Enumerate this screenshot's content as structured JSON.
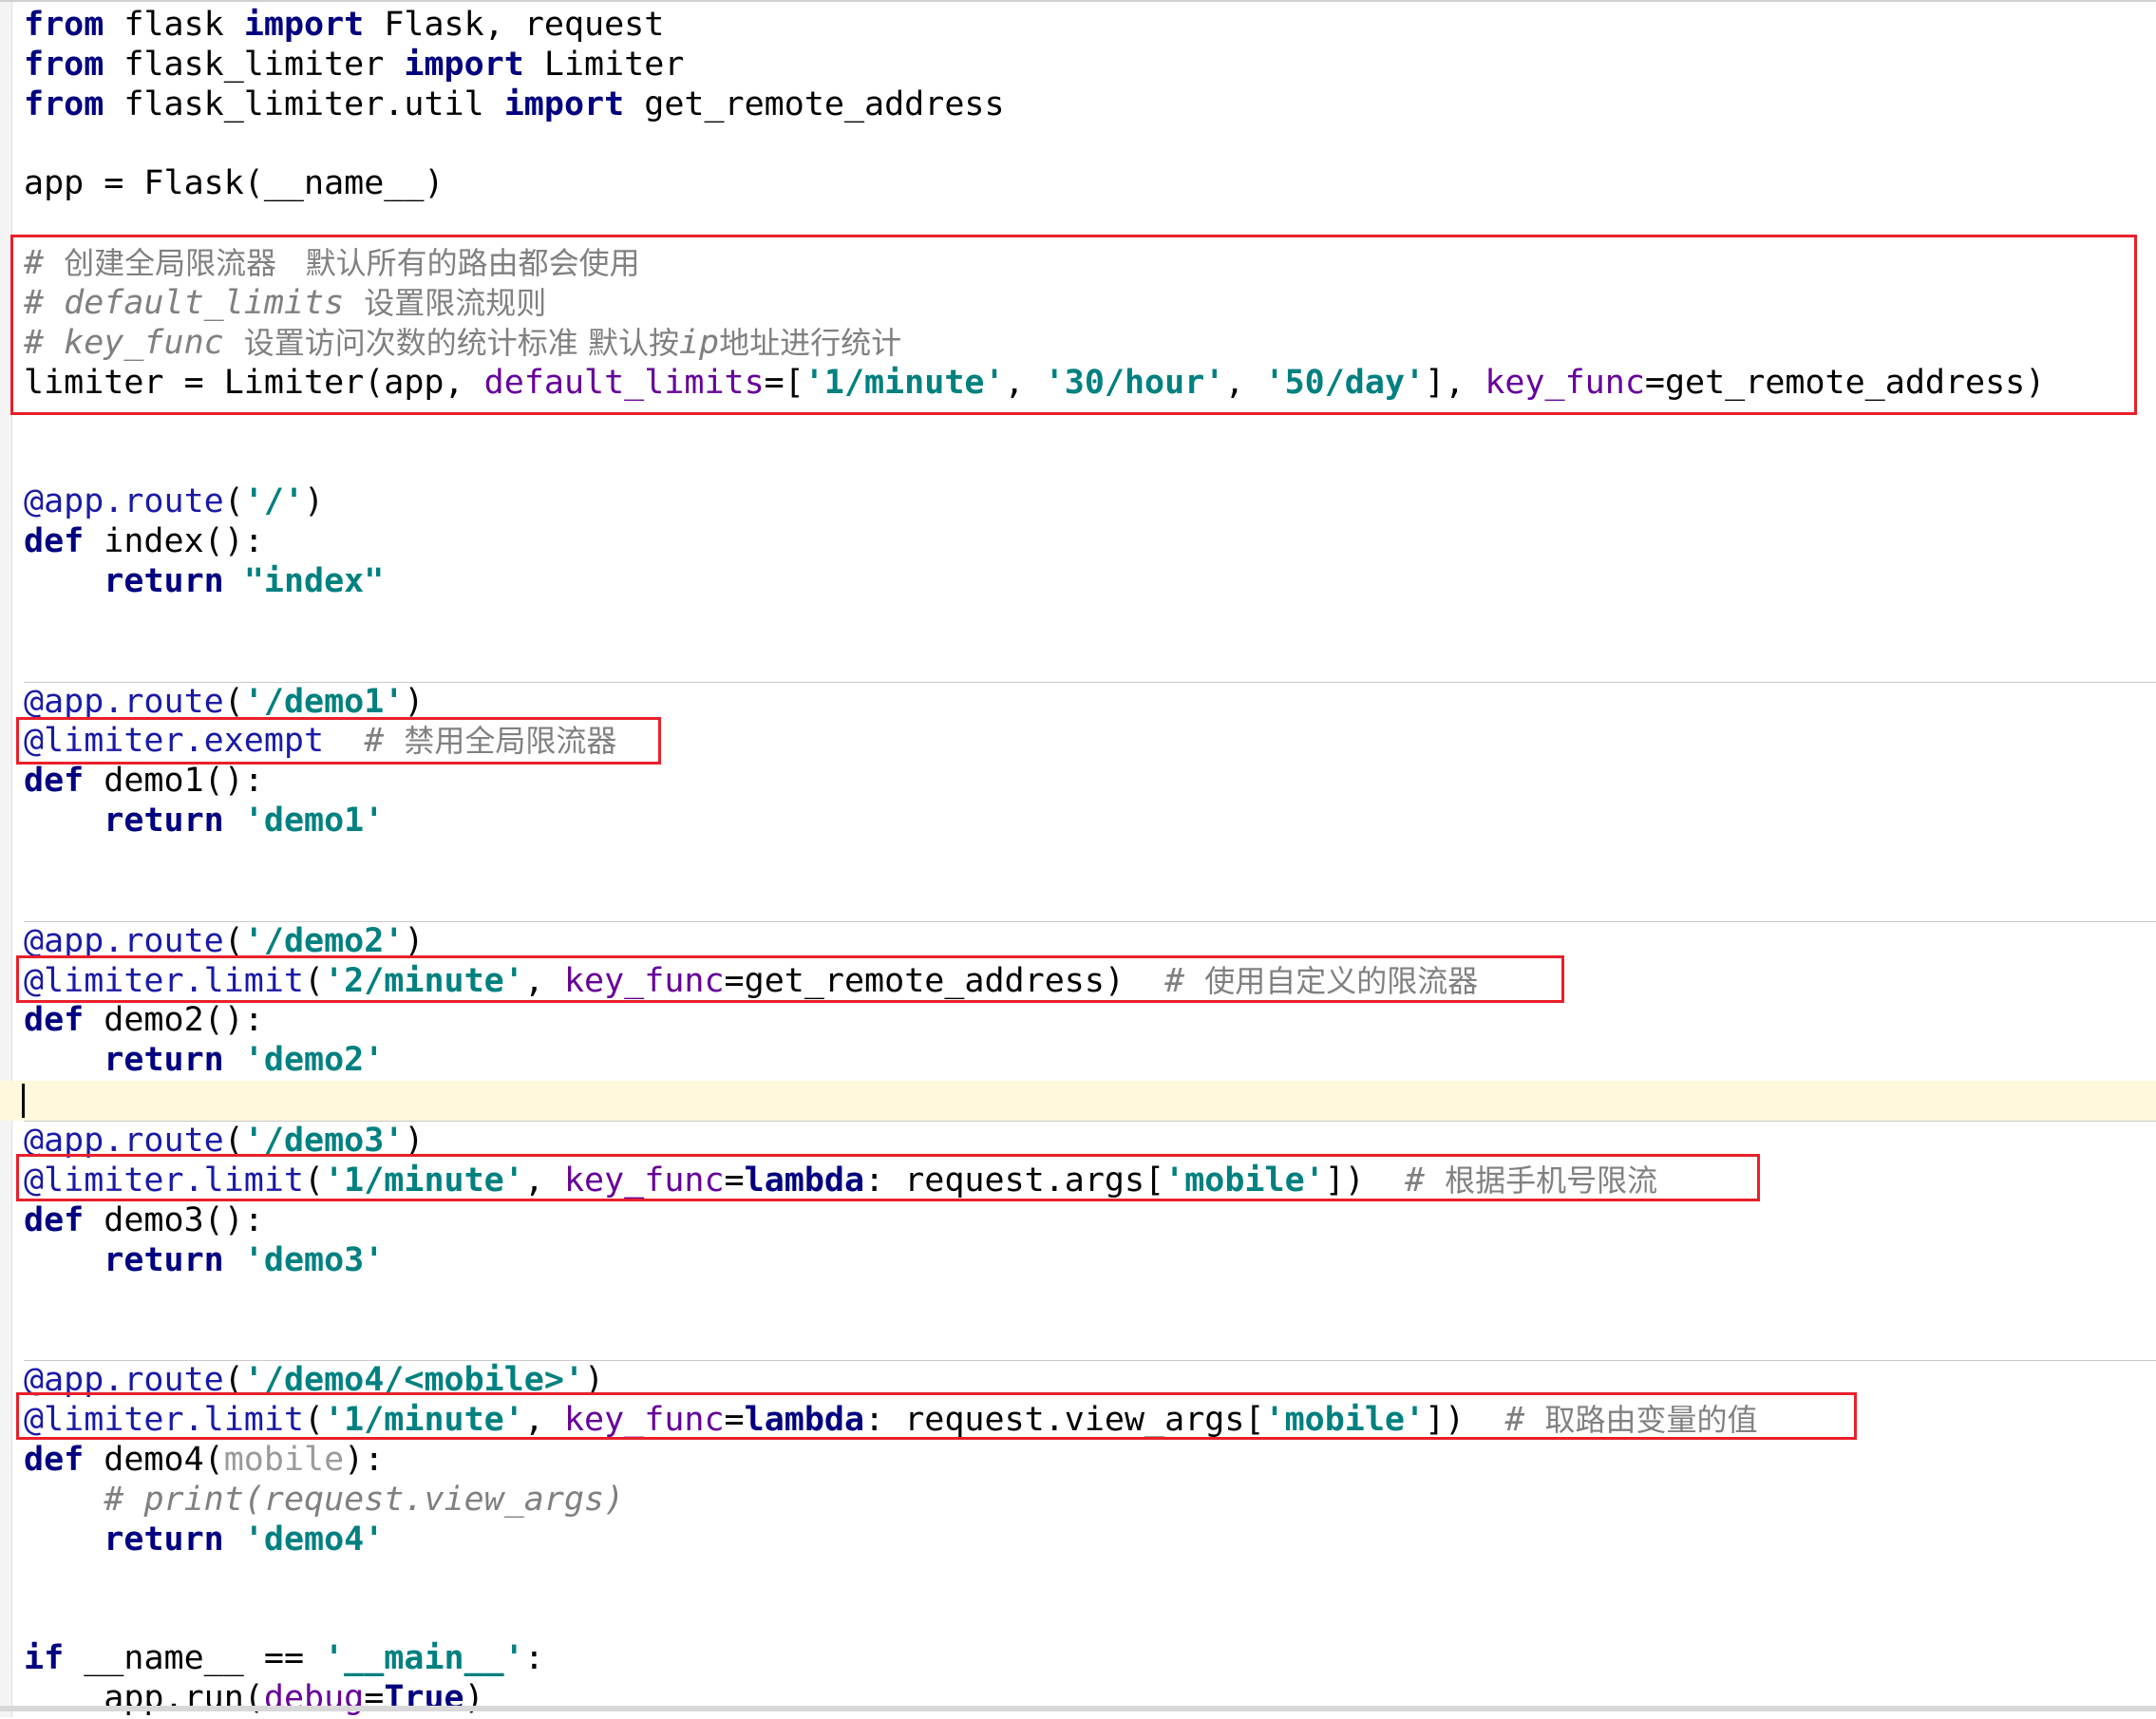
{
  "editor": {
    "language": "python",
    "highlight_color": "#e8202a",
    "current_line": 27,
    "lines": [
      [
        [
          "kw",
          "from"
        ],
        [
          "plain",
          " flask "
        ],
        [
          "kw",
          "import"
        ],
        [
          "plain",
          " Flask, request"
        ]
      ],
      [
        [
          "kw",
          "from"
        ],
        [
          "plain",
          " flask_limiter "
        ],
        [
          "kw",
          "import"
        ],
        [
          "plain",
          " Limiter"
        ]
      ],
      [
        [
          "kw",
          "from"
        ],
        [
          "plain",
          " flask_limiter.util "
        ],
        [
          "kw",
          "import"
        ],
        [
          "plain",
          " get_remote_address"
        ]
      ],
      [],
      [
        [
          "plain",
          "app = Flask(__name__)"
        ]
      ],
      [],
      [
        [
          "cmt",
          "# "
        ],
        [
          "cjk",
          "创建全局限流器   默认所有的路由都会使用"
        ]
      ],
      [
        [
          "cmt",
          "# default_limits "
        ],
        [
          "cjk",
          "设置限流规则"
        ]
      ],
      [
        [
          "cmt",
          "# key_func "
        ],
        [
          "cjk",
          "设置访问次数的统计标准 默认按"
        ],
        [
          "cmt",
          "ip"
        ],
        [
          "cjk",
          "地址进行统计"
        ]
      ],
      [
        [
          "plain",
          "limiter = Limiter(app, "
        ],
        [
          "kwarg",
          "default_limits"
        ],
        [
          "plain",
          "=["
        ],
        [
          "str",
          "'1/minute'"
        ],
        [
          "plain",
          ", "
        ],
        [
          "str",
          "'30/hour'"
        ],
        [
          "plain",
          ", "
        ],
        [
          "str",
          "'50/day'"
        ],
        [
          "plain",
          "], "
        ],
        [
          "kwarg",
          "key_func"
        ],
        [
          "plain",
          "=get_remote_address)"
        ]
      ],
      [],
      [],
      [
        [
          "dec",
          "@app.route"
        ],
        [
          "plain",
          "("
        ],
        [
          "str",
          "'/'"
        ],
        [
          "plain",
          ")"
        ]
      ],
      [
        [
          "kw",
          "def"
        ],
        [
          "plain",
          " index():"
        ]
      ],
      [
        [
          "plain",
          "    "
        ],
        [
          "kw",
          "return"
        ],
        [
          "plain",
          " "
        ],
        [
          "str",
          "\"index\""
        ]
      ],
      [],
      [],
      [
        [
          "dec",
          "@app.route"
        ],
        [
          "plain",
          "("
        ],
        [
          "str",
          "'/demo1'"
        ],
        [
          "plain",
          ")"
        ]
      ],
      [
        [
          "dec",
          "@limiter.exempt"
        ],
        [
          "plain",
          "  "
        ],
        [
          "cmt",
          "# "
        ],
        [
          "cjk",
          "禁用全局限流器"
        ]
      ],
      [
        [
          "kw",
          "def"
        ],
        [
          "plain",
          " demo1():"
        ]
      ],
      [
        [
          "plain",
          "    "
        ],
        [
          "kw",
          "return"
        ],
        [
          "plain",
          " "
        ],
        [
          "str",
          "'demo1'"
        ]
      ],
      [],
      [],
      [
        [
          "dec",
          "@app.route"
        ],
        [
          "plain",
          "("
        ],
        [
          "str",
          "'/demo2'"
        ],
        [
          "plain",
          ")"
        ]
      ],
      [
        [
          "dec",
          "@limiter.limit"
        ],
        [
          "plain",
          "("
        ],
        [
          "str",
          "'2/minute'"
        ],
        [
          "plain",
          ", "
        ],
        [
          "kwarg",
          "key_func"
        ],
        [
          "plain",
          "=get_remote_address)  "
        ],
        [
          "cmt",
          "# "
        ],
        [
          "cjk",
          "使用自定义的限流器"
        ]
      ],
      [
        [
          "kw",
          "def"
        ],
        [
          "plain",
          " demo2():"
        ]
      ],
      [
        [
          "plain",
          "    "
        ],
        [
          "kw",
          "return"
        ],
        [
          "plain",
          " "
        ],
        [
          "str",
          "'demo2'"
        ]
      ],
      [],
      [
        [
          "dec",
          "@app.route"
        ],
        [
          "plain",
          "("
        ],
        [
          "str",
          "'/demo3'"
        ],
        [
          "plain",
          ")"
        ]
      ],
      [
        [
          "dec",
          "@limiter.limit"
        ],
        [
          "plain",
          "("
        ],
        [
          "str",
          "'1/minute'"
        ],
        [
          "plain",
          ", "
        ],
        [
          "kwarg",
          "key_func"
        ],
        [
          "plain",
          "="
        ],
        [
          "kw",
          "lambda"
        ],
        [
          "plain",
          ": request.args["
        ],
        [
          "str",
          "'mobile'"
        ],
        [
          "plain",
          "])  "
        ],
        [
          "cmt",
          "# "
        ],
        [
          "cjk",
          "根据手机号限流"
        ]
      ],
      [
        [
          "kw",
          "def"
        ],
        [
          "plain",
          " demo3():"
        ]
      ],
      [
        [
          "plain",
          "    "
        ],
        [
          "kw",
          "return"
        ],
        [
          "plain",
          " "
        ],
        [
          "str",
          "'demo3'"
        ]
      ],
      [],
      [],
      [
        [
          "dec",
          "@app.route"
        ],
        [
          "plain",
          "("
        ],
        [
          "str",
          "'/demo4/<mobile>'"
        ],
        [
          "plain",
          ")"
        ]
      ],
      [
        [
          "dec",
          "@limiter.limit"
        ],
        [
          "plain",
          "("
        ],
        [
          "str",
          "'1/minute'"
        ],
        [
          "plain",
          ", "
        ],
        [
          "kwarg",
          "key_func"
        ],
        [
          "plain",
          "="
        ],
        [
          "kw",
          "lambda"
        ],
        [
          "plain",
          ": request.view_args["
        ],
        [
          "str",
          "'mobile'"
        ],
        [
          "plain",
          "])  "
        ],
        [
          "cmt",
          "# "
        ],
        [
          "cjk",
          "取路由变量的值"
        ]
      ],
      [
        [
          "kw",
          "def"
        ],
        [
          "plain",
          " demo4("
        ],
        [
          "param",
          "mobile"
        ],
        [
          "plain",
          "):"
        ]
      ],
      [
        [
          "plain",
          "    "
        ],
        [
          "cmt",
          "# print(request.view_args)"
        ]
      ],
      [
        [
          "plain",
          "    "
        ],
        [
          "kw",
          "return"
        ],
        [
          "plain",
          " "
        ],
        [
          "str",
          "'demo4'"
        ]
      ],
      [],
      [],
      [
        [
          "kw",
          "if"
        ],
        [
          "plain",
          " __name__ == "
        ],
        [
          "str",
          "'__main__'"
        ],
        [
          "plain",
          ":"
        ]
      ],
      [
        [
          "plain",
          "    app.run("
        ],
        [
          "kwarg",
          "debug"
        ],
        [
          "plain",
          "="
        ],
        [
          "kw",
          "True"
        ],
        [
          "plain",
          ")"
        ]
      ]
    ]
  }
}
